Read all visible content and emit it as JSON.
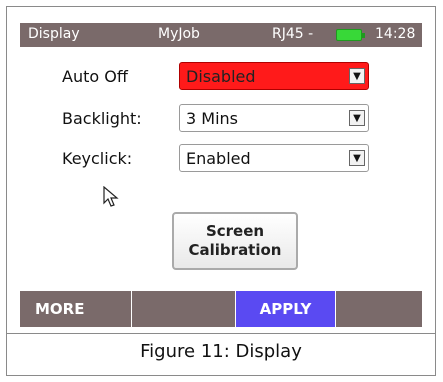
{
  "statusbar": {
    "screen": "Display",
    "job": "MyJob",
    "port": "RJ45 -",
    "time": "14:28",
    "battery_color": "#38d838"
  },
  "settings": [
    {
      "label": "Auto Off",
      "value": "Disabled",
      "highlighted": true,
      "highlight_color": "#ff1a1a"
    },
    {
      "label": "Backlight:",
      "value": "3 Mins"
    },
    {
      "label": "Keyclick:",
      "value": "Enabled"
    }
  ],
  "calibration_button": {
    "line1": "Screen",
    "line2": "Calibration"
  },
  "softkeys": [
    {
      "label": "MORE"
    },
    {
      "label": ""
    },
    {
      "label": "APPLY",
      "active": true,
      "active_color": "#5a4af2"
    },
    {
      "label": ""
    }
  ],
  "caption": "Figure 11: Display",
  "icons": {
    "dropdown": "dropdown-arrow-icon",
    "cursor": "mouse-pointer-icon",
    "battery": "battery-icon"
  }
}
